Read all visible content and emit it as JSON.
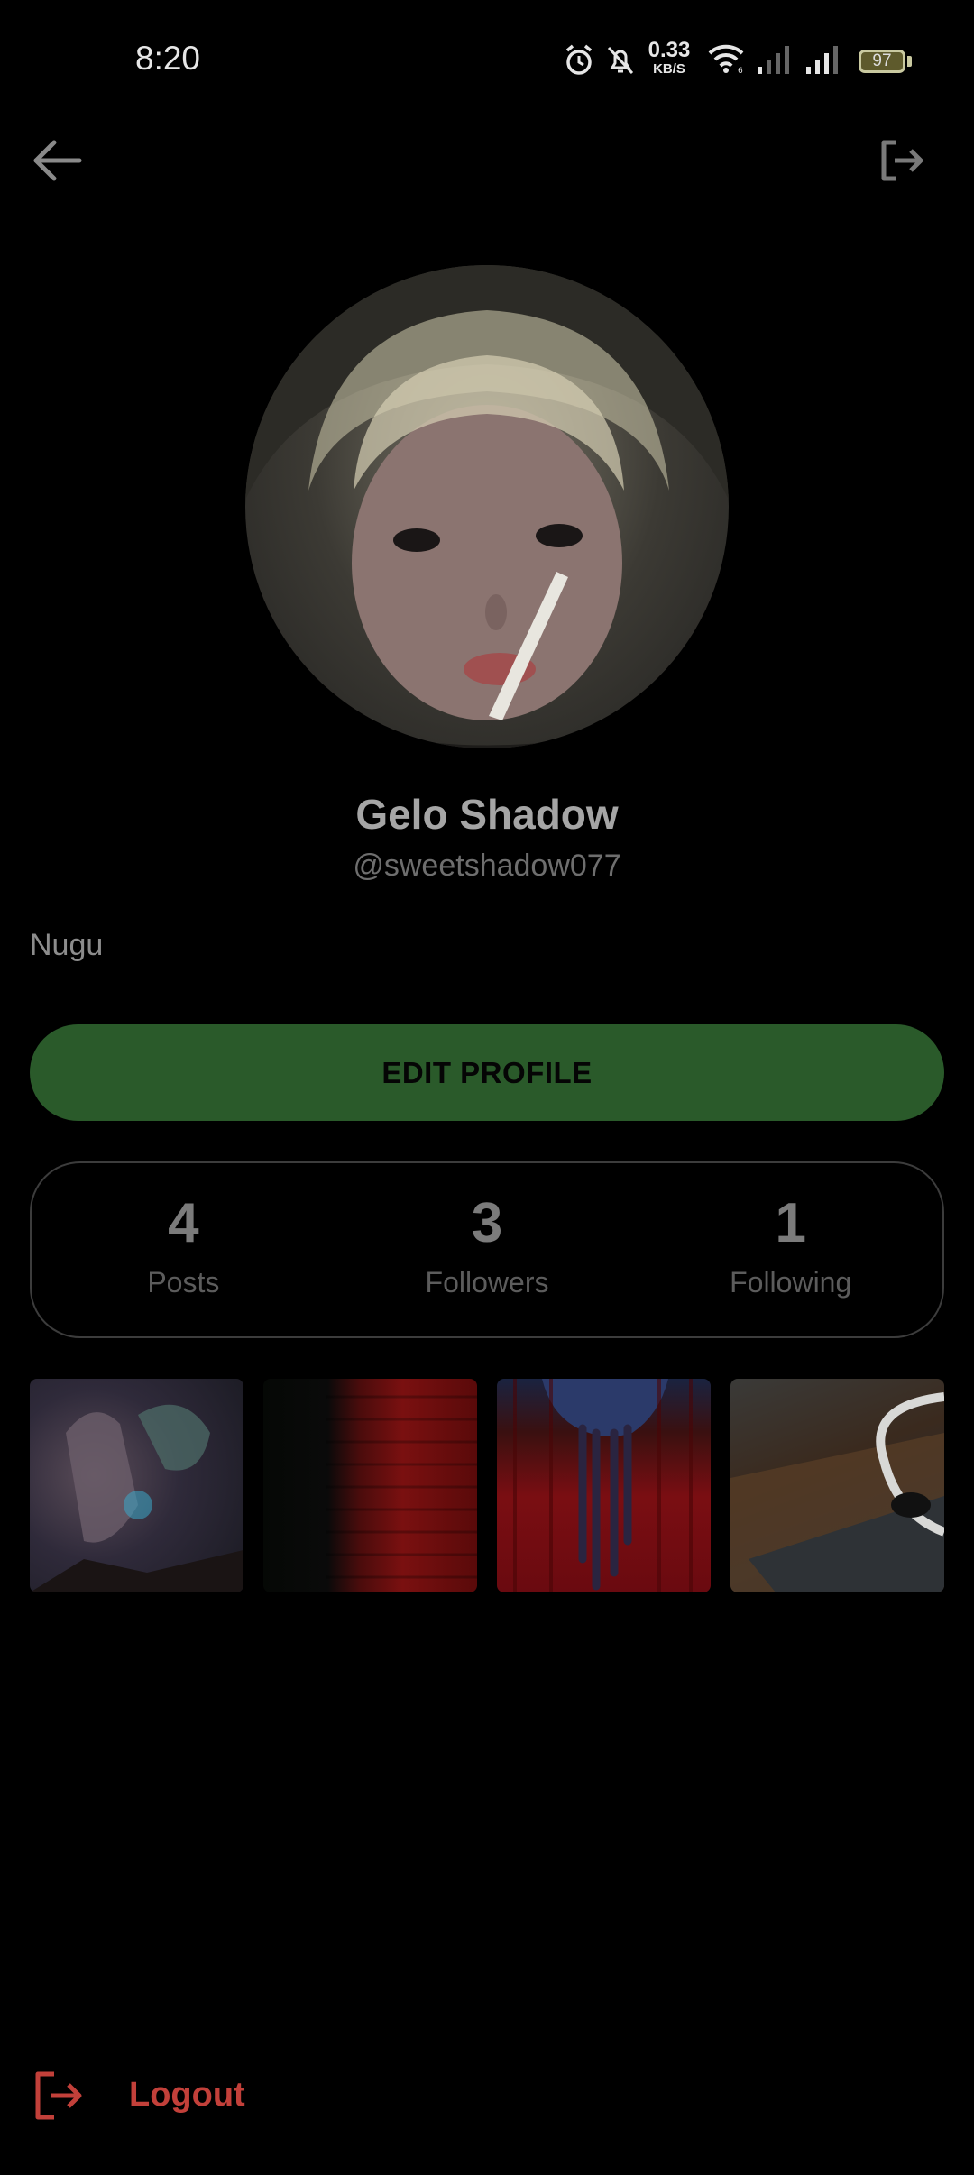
{
  "status_bar": {
    "time": "8:20",
    "net_speed_value": "0.33",
    "net_speed_unit": "KB/S",
    "battery": "97",
    "icons": [
      "alarm-icon",
      "bell-off-icon",
      "wifi-icon",
      "signal-icon",
      "signal-icon",
      "battery-icon"
    ]
  },
  "header": {
    "back_icon": "arrow-left-icon",
    "exit_icon": "exit-icon"
  },
  "profile": {
    "name": "Gelo Shadow",
    "handle": "@sweetshadow077",
    "bio": "Nugu",
    "edit_button": "EDIT PROFILE"
  },
  "stats": [
    {
      "value": "4",
      "label": "Posts"
    },
    {
      "value": "3",
      "label": "Followers"
    },
    {
      "value": "1",
      "label": "Following"
    }
  ],
  "posts": [
    {
      "thumb": "post-thumbnail-1"
    },
    {
      "thumb": "post-thumbnail-2"
    },
    {
      "thumb": "post-thumbnail-3"
    },
    {
      "thumb": "post-thumbnail-4"
    }
  ],
  "footer": {
    "logout_label": "Logout",
    "logout_icon": "logout-icon"
  },
  "colors": {
    "background": "#000000",
    "edit_button_bg": "#2a5a2a",
    "logout": "#c2403a"
  }
}
